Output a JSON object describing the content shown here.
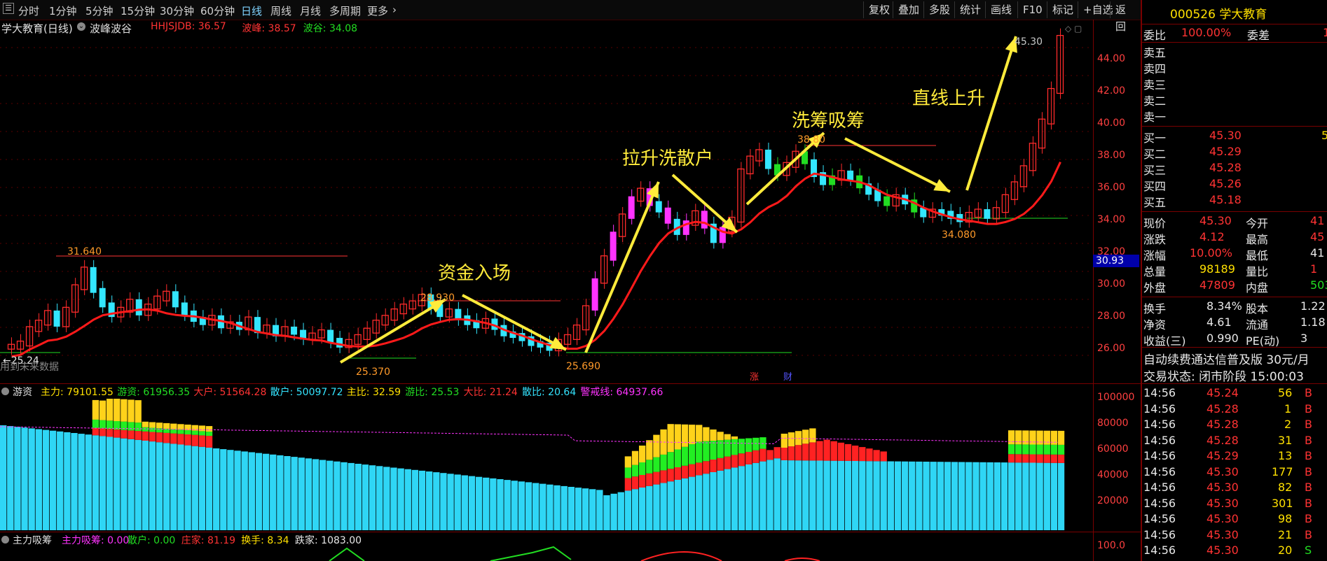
{
  "toolbar": {
    "periods": [
      "分时",
      "1分钟",
      "5分钟",
      "15分钟",
      "30分钟",
      "60分钟",
      "日线",
      "周线",
      "月线",
      "多周期",
      "更多"
    ],
    "active_period": "日线",
    "right_buttons": [
      "复权",
      "叠加",
      "多股",
      "统计",
      "画线",
      "F10",
      "标记",
      "+自选",
      "返回"
    ]
  },
  "main_chart": {
    "stock_label": "学大教育(日线)",
    "indicator_name": "波峰波谷",
    "indicators": [
      {
        "text": "HHJSJDB: 36.57",
        "color": "#ff3333"
      },
      {
        "text": "波峰: 38.57",
        "color": "#ff3333"
      },
      {
        "text": "波谷: 34.08",
        "color": "#22dd22"
      }
    ],
    "price_axis": [
      "44.00",
      "42.00",
      "40.00",
      "38.00",
      "36.00",
      "34.00",
      "32.00",
      "30.00",
      "28.00",
      "26.00"
    ],
    "current_price_tag": "30.93",
    "price_labels": [
      "31.640",
      "28.930",
      "25.370",
      "25.690",
      "38.80",
      "34.080",
      "45.30",
      "25.24"
    ],
    "annotations": [
      "资金入场",
      "拉升洗散户",
      "洗筹吸筹",
      "直线上升"
    ],
    "bottom_left": "用到未来数据",
    "event_markers": [
      "涨",
      "财"
    ]
  },
  "youzi_panel": {
    "name": "游资",
    "fields": [
      {
        "text": "主力: 79101.55",
        "color": "#ffe000"
      },
      {
        "text": "游资: 61956.35",
        "color": "#22dd22"
      },
      {
        "text": "大户: 51564.28",
        "color": "#ff3333"
      },
      {
        "text": "散户: 50097.72",
        "color": "#34e4ff"
      },
      {
        "text": "主比: 32.59",
        "color": "#ffe000"
      },
      {
        "text": "游比: 25.53",
        "color": "#22dd22"
      },
      {
        "text": "大比: 21.24",
        "color": "#ff3333"
      },
      {
        "text": "散比: 20.64",
        "color": "#34e4ff"
      },
      {
        "text": "警戒线: 64937.66",
        "color": "#ff33ff"
      }
    ],
    "axis": [
      "100000",
      "80000",
      "60000",
      "40000",
      "20000"
    ]
  },
  "zhuli_panel": {
    "name": "主力吸筹",
    "fields": [
      {
        "text": "主力吸筹: 0.00",
        "color": "#ff33ff"
      },
      {
        "text": "散户: 0.00",
        "color": "#22dd22"
      },
      {
        "text": "庄家: 81.19",
        "color": "#ff3333"
      },
      {
        "text": "换手: 8.34",
        "color": "#ffe000"
      },
      {
        "text": "跌家: 1083.00",
        "color": "#e8e8e8"
      }
    ],
    "axis": [
      "100.0"
    ]
  },
  "quote_panel": {
    "code": "000526",
    "name": "学大教育",
    "weibi_label": "委比",
    "weibi_value": "100.00%",
    "weicha_label": "委差",
    "weicha_value": "1",
    "sells": [
      {
        "label": "卖五"
      },
      {
        "label": "卖四"
      },
      {
        "label": "卖三"
      },
      {
        "label": "卖二"
      },
      {
        "label": "卖一"
      }
    ],
    "buys": [
      {
        "label": "买一",
        "price": "45.30",
        "vol": "5"
      },
      {
        "label": "买二",
        "price": "45.29",
        "vol": ""
      },
      {
        "label": "买三",
        "price": "45.28",
        "vol": ""
      },
      {
        "label": "买四",
        "price": "45.26",
        "vol": ""
      },
      {
        "label": "买五",
        "price": "45.18",
        "vol": ""
      }
    ],
    "stats": [
      {
        "l1": "现价",
        "v1": "45.30",
        "c1": "#ff3333",
        "l2": "今开",
        "v2": "41",
        "c2": "#ff3333"
      },
      {
        "l1": "涨跌",
        "v1": "4.12",
        "c1": "#ff3333",
        "l2": "最高",
        "v2": "45",
        "c2": "#ff3333"
      },
      {
        "l1": "涨幅",
        "v1": "10.00%",
        "c1": "#ff3333",
        "l2": "最低",
        "v2": "41",
        "c2": "#e8e8e8"
      },
      {
        "l1": "总量",
        "v1": "98189",
        "c1": "#ffe000",
        "l2": "量比",
        "v2": "1",
        "c2": "#ff3333"
      },
      {
        "l1": "外盘",
        "v1": "47809",
        "c1": "#ff3333",
        "l2": "内盘",
        "v2": "503",
        "c2": "#22dd22"
      }
    ],
    "stats2": [
      {
        "l1": "换手",
        "v1": "8.34%",
        "l2": "股本",
        "v2": "1.22"
      },
      {
        "l1": "净资",
        "v1": "4.61",
        "l2": "流通",
        "v2": "1.18"
      },
      {
        "l1": "收益(三)",
        "v1": "0.990",
        "l2": "PE(动)",
        "v2": "3"
      }
    ],
    "ticker": "自动续费通达信普及版 30元/月",
    "status": "交易状态: 闭市阶段 15:00:03",
    "ticks": [
      {
        "t": "14:56",
        "p": "45.24",
        "v": "56",
        "s": "B"
      },
      {
        "t": "14:56",
        "p": "45.28",
        "v": "1",
        "s": "B"
      },
      {
        "t": "14:56",
        "p": "45.28",
        "v": "2",
        "s": "B"
      },
      {
        "t": "14:56",
        "p": "45.28",
        "v": "31",
        "s": "B"
      },
      {
        "t": "14:56",
        "p": "45.29",
        "v": "13",
        "s": "B"
      },
      {
        "t": "14:56",
        "p": "45.30",
        "v": "177",
        "s": "B"
      },
      {
        "t": "14:56",
        "p": "45.30",
        "v": "82",
        "s": "B"
      },
      {
        "t": "14:56",
        "p": "45.30",
        "v": "301",
        "s": "B"
      },
      {
        "t": "14:56",
        "p": "45.30",
        "v": "98",
        "s": "B"
      },
      {
        "t": "14:56",
        "p": "45.30",
        "v": "21",
        "s": "B"
      },
      {
        "t": "14:56",
        "p": "45.30",
        "v": "20",
        "s": "S"
      }
    ]
  }
}
